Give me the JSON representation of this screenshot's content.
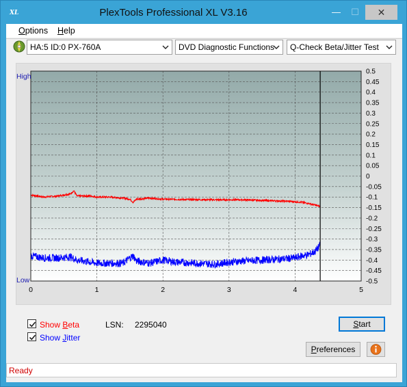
{
  "window": {
    "title": "PlexTools Professional XL V3.16",
    "app_icon_text": "XL",
    "minimize_glyph": "—",
    "maximize_glyph": "☐",
    "close_glyph": "✕"
  },
  "menu": [
    {
      "label_prefix": "",
      "mnemonic": "O",
      "label_suffix": "ptions"
    },
    {
      "label_prefix": "",
      "mnemonic": "H",
      "label_suffix": "elp"
    }
  ],
  "toolbar": {
    "drive": "HA:5 ID:0  PX-760A",
    "function": "DVD Diagnostic Functions",
    "test": "Q-Check Beta/Jitter Test"
  },
  "chart_data": {
    "type": "line",
    "x_ticks": [
      "0",
      "1",
      "2",
      "3",
      "4",
      "5"
    ],
    "xlim": [
      0,
      5
    ],
    "left_labels": {
      "high": "High",
      "low": "Low"
    },
    "y_ticks": [
      "0.5",
      "0.45",
      "0.4",
      "0.35",
      "0.3",
      "0.25",
      "0.2",
      "0.15",
      "0.1",
      "0.05",
      "0",
      "-0.05",
      "-0.1",
      "-0.15",
      "-0.2",
      "-0.25",
      "-0.3",
      "-0.35",
      "-0.4",
      "-0.45",
      "-0.5"
    ],
    "ylim": [
      -0.5,
      0.5
    ],
    "grid": true,
    "end_marker_x": 4.38,
    "series": [
      {
        "name": "Beta",
        "color": "#ff0000",
        "x": [
          0,
          0.2,
          0.4,
          0.6,
          0.65,
          0.7,
          0.9,
          1.0,
          1.2,
          1.4,
          1.5,
          1.55,
          1.6,
          1.8,
          2.0,
          2.4,
          2.8,
          3.2,
          3.6,
          3.9,
          4.1,
          4.2,
          4.3,
          4.38
        ],
        "y": [
          -0.09,
          -0.1,
          -0.095,
          -0.085,
          -0.07,
          -0.095,
          -0.095,
          -0.1,
          -0.1,
          -0.105,
          -0.11,
          -0.125,
          -0.11,
          -0.105,
          -0.11,
          -0.112,
          -0.113,
          -0.113,
          -0.117,
          -0.12,
          -0.125,
          -0.13,
          -0.138,
          -0.145
        ]
      },
      {
        "name": "Jitter",
        "color": "#0000ff",
        "x": [
          0,
          0.2,
          0.4,
          0.6,
          0.7,
          0.9,
          1.0,
          1.2,
          1.4,
          1.5,
          1.55,
          1.6,
          1.8,
          2.0,
          2.2,
          2.5,
          2.8,
          3.0,
          3.2,
          3.5,
          3.8,
          4.0,
          4.1,
          4.2,
          4.3,
          4.38
        ],
        "y": [
          -0.38,
          -0.39,
          -0.39,
          -0.385,
          -0.4,
          -0.41,
          -0.415,
          -0.415,
          -0.415,
          -0.39,
          -0.38,
          -0.405,
          -0.415,
          -0.4,
          -0.41,
          -0.415,
          -0.42,
          -0.41,
          -0.405,
          -0.4,
          -0.395,
          -0.39,
          -0.38,
          -0.375,
          -0.36,
          -0.33
        ]
      }
    ]
  },
  "options": {
    "show_beta": {
      "prefix": "Show ",
      "mnemonic": "B",
      "suffix": "eta",
      "checked": true,
      "color": "#ff0000"
    },
    "show_jitter": {
      "prefix": "Show ",
      "mnemonic": "J",
      "suffix": "itter",
      "checked": true,
      "color": "#0000ff"
    }
  },
  "lsn": {
    "label": "LSN:",
    "value": "2295040"
  },
  "buttons": {
    "start": {
      "mnemonic": "S",
      "suffix": "tart"
    },
    "preferences": {
      "mnemonic": "P",
      "suffix": "references"
    }
  },
  "status": {
    "text": "Ready",
    "color": "#d00000"
  }
}
